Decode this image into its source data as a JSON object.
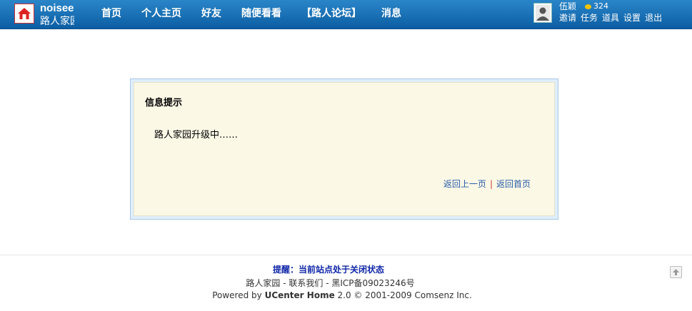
{
  "header": {
    "logo_line1": "noisee",
    "logo_line2": "路人家园",
    "nav": [
      "首页",
      "个人主页",
      "好友",
      "随便看看",
      "【路人论坛】",
      "消息"
    ],
    "user": {
      "name": "伍颖",
      "coins": "324",
      "links": [
        "邀请",
        "任务",
        "道具",
        "设置",
        "退出"
      ]
    }
  },
  "message": {
    "title": "信息提示",
    "body": "路人家园升级中……",
    "back_link": "返回上一页",
    "separator": "|",
    "home_link": "返回首页"
  },
  "footer": {
    "notice": "提醒：当前站点处于关闭状态",
    "site_name": "路人家园",
    "contact_sep": " - ",
    "contact": "联系我们",
    "icp_sep": " - ",
    "icp": "黑ICP备09023246号",
    "powered_prefix": "Powered by ",
    "powered_product": "UCenter Home",
    "powered_suffix": " 2.0 © 2001-2009 Comsenz Inc."
  },
  "colors": {
    "header_bg": "#0c5da3",
    "link": "#2a5caa",
    "notice": "#1027a8",
    "box_bg": "#fbf8e6"
  }
}
